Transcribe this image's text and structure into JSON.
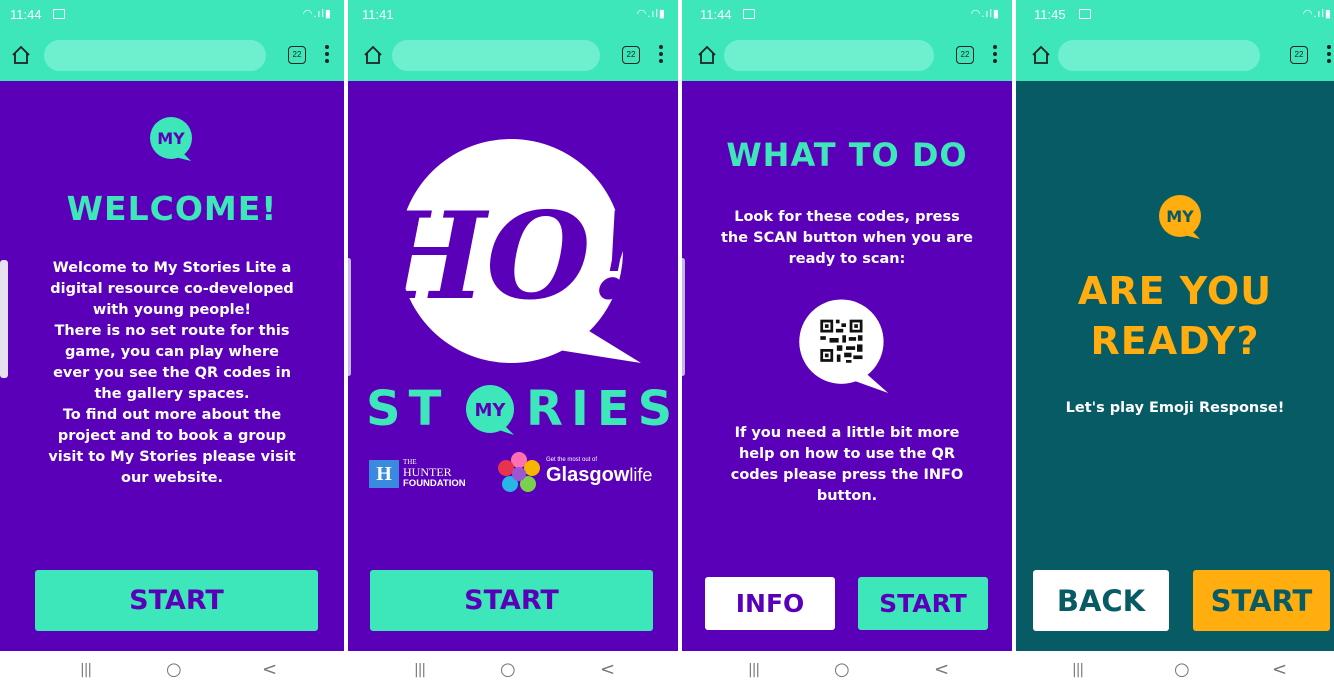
{
  "colors": {
    "status_bar": "#3de7b9",
    "purple_bg": "#5a00b9",
    "teal_bg": "#075b65",
    "accent_green": "#3de7b9",
    "accent_orange": "#ffad0f",
    "text_purple": "#5a00b9"
  },
  "screens": [
    {
      "time": "11:44",
      "tab_count": "22",
      "logo_text": "MY",
      "heading": "WELCOME!",
      "body": [
        "Welcome to My Stories Lite a",
        "digital resource co-developed",
        "with young people!",
        "There is no set route for this",
        "game, you can play where",
        "ever you see the QR codes in",
        "the gallery spaces.",
        "To find out more about the",
        "project and to book a group",
        "visit to My Stories please visit",
        "our website."
      ],
      "start_label": "START"
    },
    {
      "time": "11:41",
      "tab_count": "22",
      "big_logo_text": "HO!",
      "stories_left": "ST",
      "stories_my": "MY",
      "stories_right": "RIES",
      "partner1_small": "THE",
      "partner1_top": "HUNTER",
      "partner1_bottom": "FOUNDATION",
      "partner2_tagline": "Get the most out of",
      "partner2_name": "Glasgow",
      "partner2_suffix": "life",
      "start_label": "START"
    },
    {
      "time": "11:44",
      "tab_count": "22",
      "heading": "WHAT TO DO",
      "body_top": [
        "Look for these codes, press",
        "the SCAN button when you are",
        "ready to scan:"
      ],
      "body_bottom": [
        "If you need a little bit more",
        "help on how to use the QR",
        "codes please press the INFO",
        "button."
      ],
      "info_label": "INFO",
      "start_label": "START"
    },
    {
      "time": "11:45",
      "tab_count": "22",
      "logo_text": "MY",
      "heading_line1": "ARE YOU",
      "heading_line2": "READY?",
      "subtitle": "Let's play Emoji Response!",
      "back_label": "BACK",
      "start_label": "START"
    }
  ],
  "nav_icons": [
    "recent-apps-icon",
    "home-icon",
    "back-icon"
  ],
  "nav_glyphs": {
    "recent": "|||",
    "home": "○",
    "back": "<"
  }
}
